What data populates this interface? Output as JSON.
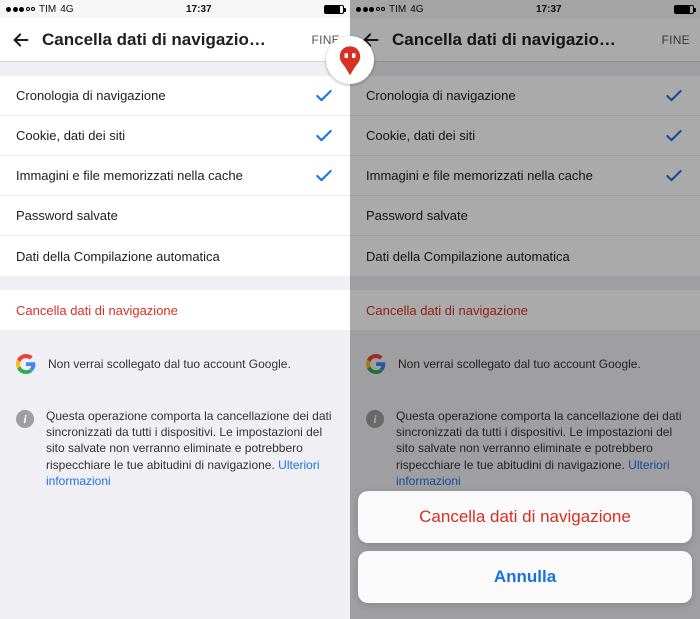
{
  "statusbar": {
    "carrier": "TIM",
    "network": "4G",
    "time": "17:37"
  },
  "header": {
    "title": "Cancella dati di navigazio…",
    "done": "FINE"
  },
  "items": [
    {
      "label": "Cronologia di navigazione",
      "checked": true
    },
    {
      "label": "Cookie, dati dei siti",
      "checked": true
    },
    {
      "label": "Immagini e file memorizzati nella cache",
      "checked": true
    },
    {
      "label": "Password salvate",
      "checked": false
    },
    {
      "label": "Dati della Compilazione automatica",
      "checked": false
    }
  ],
  "clear_button": "Cancella dati di navigazione",
  "google_notice": "Non verrai scollegato dal tuo account Google.",
  "info": {
    "text": "Questa operazione comporta la cancellazione dei dati sincronizzati da tutti i dispositivi. Le impostazioni del sito salvate non verranno eliminate e potrebbero rispecchiare le tue abitudini di navigazione. ",
    "link": "Ulteriori informazioni"
  },
  "sheet": {
    "confirm": "Cancella dati di navigazione",
    "cancel": "Annulla"
  },
  "colors": {
    "accent": "#1a73e8",
    "danger": "#d93025"
  }
}
